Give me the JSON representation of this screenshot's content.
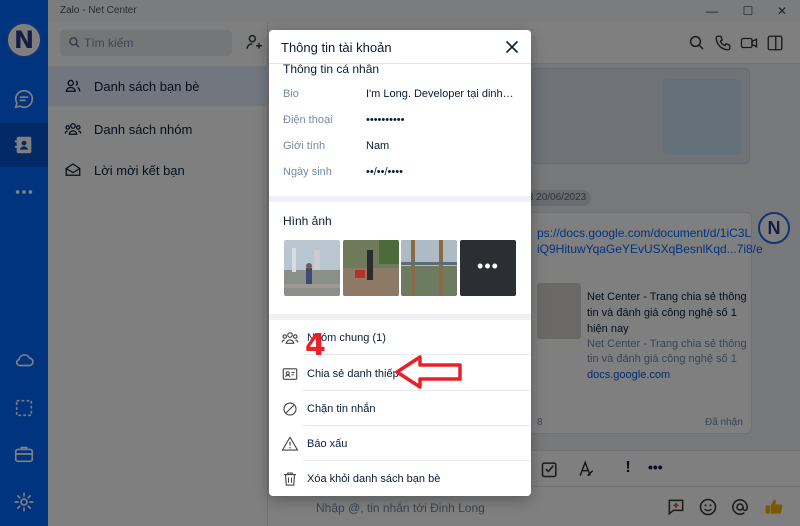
{
  "window": {
    "title": "Zalo - Net Center",
    "minimize": "—",
    "maximize": "☐",
    "close": "✕"
  },
  "nav": {
    "avatar_letter": "N"
  },
  "sidebar": {
    "search_placeholder": "Tìm kiếm",
    "items": [
      {
        "label": "Danh sách bạn bè",
        "active": true
      },
      {
        "label": "Danh sách nhóm",
        "active": false
      },
      {
        "label": "Lời mời kết bạn",
        "active": false
      }
    ]
  },
  "chat": {
    "date_pill": "8 20/06/2023",
    "link_text": "ps://docs.google.com/document/d/1iC3L iQ9HituwYqaGeYEvUSXqBesnlKqd...7i8/e",
    "preview_title": "Net Center - Trang chia sẻ thông tin và đánh giá công nghệ số 1 hiện nay",
    "preview_desc": "Net Center - Trang chia sẻ thông tin và đánh giá công nghệ số 1",
    "preview_domain": "docs.google.com",
    "time": "8",
    "status": "Đã nhận",
    "avatar_letter": "N",
    "compose_placeholder": "Nhập @, tin nhắn tới Đinh Long",
    "toolbar_more": "•••",
    "toolbar_important": "!"
  },
  "modal": {
    "title": "Thông tin tài khoản",
    "personal_section": "Thông tin cá nhân",
    "fields": [
      {
        "label": "Bio",
        "value": "I'm Long. Developer tại dinhlo..."
      },
      {
        "label": "Điện thoại",
        "value": "••••••••••"
      },
      {
        "label": "Giới tính",
        "value": "Nam"
      },
      {
        "label": "Ngày sinh",
        "value": "••/••/••••"
      }
    ],
    "photos_title": "Hình ảnh",
    "photos_more": "•••",
    "actions": [
      {
        "label": "Nhóm chung (1)",
        "icon": "group-icon"
      },
      {
        "label": "Chia sẻ danh thiếp",
        "icon": "contact-card-icon"
      },
      {
        "label": "Chặn tin nhắn",
        "icon": "block-icon"
      },
      {
        "label": "Báo xấu",
        "icon": "warning-icon"
      },
      {
        "label": "Xóa khỏi danh sách bạn bè",
        "icon": "trash-icon"
      }
    ]
  },
  "annotation": {
    "step_number": "4",
    "color": "#e8202a"
  },
  "colors": {
    "nav_blue": "#0068ff",
    "nav_active": "#0052cc",
    "active_row": "#e5efff",
    "text_primary": "#081c36",
    "text_secondary": "#7589a3"
  }
}
